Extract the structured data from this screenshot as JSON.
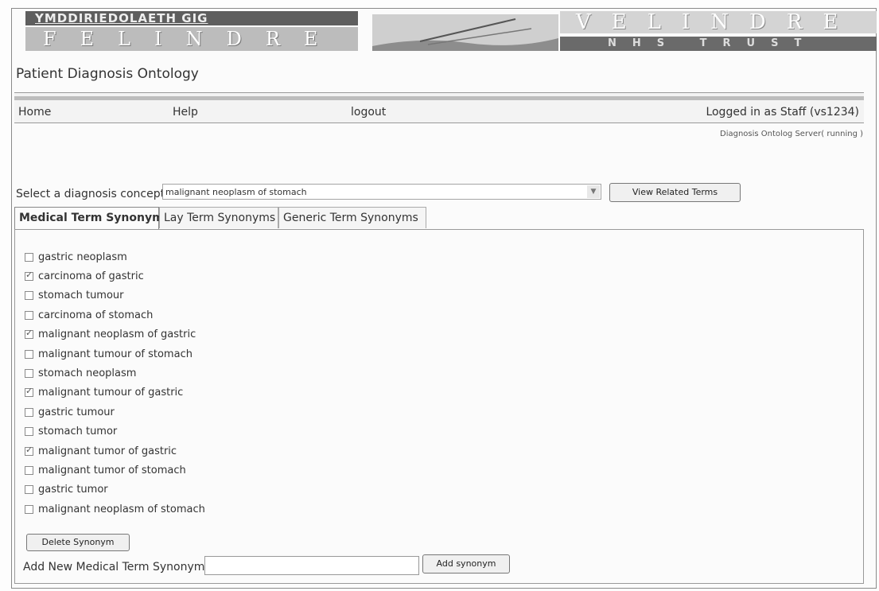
{
  "banner": {
    "welsh_name": "YMDDIRIEDOLAETH GIG",
    "left_word": "FELINDRE",
    "right_word": "VELINDRE",
    "right_sub": "NHS TRUST"
  },
  "app_title": "Patient Diagnosis Ontology",
  "nav": {
    "home": "Home",
    "help": "Help",
    "logout": "logout",
    "user": "Logged in as Staff (vs1234)"
  },
  "server_status": "Diagnosis Ontolog Server( running )",
  "concept": {
    "label": "Select a diagnosis concept",
    "selected": "malignant neoplasm of stomach",
    "view_button": "View Related Terms"
  },
  "tabs": [
    {
      "label": "Medical Term Synonyms",
      "active": true
    },
    {
      "label": "Lay Term Synonyms",
      "active": false
    },
    {
      "label": "Generic Term Synonyms",
      "active": false
    }
  ],
  "synonyms": [
    {
      "label": "gastric neoplasm",
      "checked": false
    },
    {
      "label": "carcinoma of gastric",
      "checked": true
    },
    {
      "label": "stomach tumour",
      "checked": false
    },
    {
      "label": "carcinoma of stomach",
      "checked": false
    },
    {
      "label": "malignant neoplasm of gastric",
      "checked": true
    },
    {
      "label": "malignant tumour of stomach",
      "checked": false
    },
    {
      "label": "stomach neoplasm",
      "checked": false
    },
    {
      "label": "malignant tumour of gastric",
      "checked": true
    },
    {
      "label": "gastric tumour",
      "checked": false
    },
    {
      "label": "stomach tumor",
      "checked": false
    },
    {
      "label": "malignant tumor of gastric",
      "checked": true
    },
    {
      "label": "malignant tumor of stomach",
      "checked": false
    },
    {
      "label": "gastric tumor",
      "checked": false
    },
    {
      "label": "malignant neoplasm of stomach",
      "checked": false
    }
  ],
  "actions": {
    "delete_button": "Delete Synonym",
    "add_label": "Add New Medical Term Synonym",
    "add_value": "",
    "add_button": "Add synonym"
  }
}
